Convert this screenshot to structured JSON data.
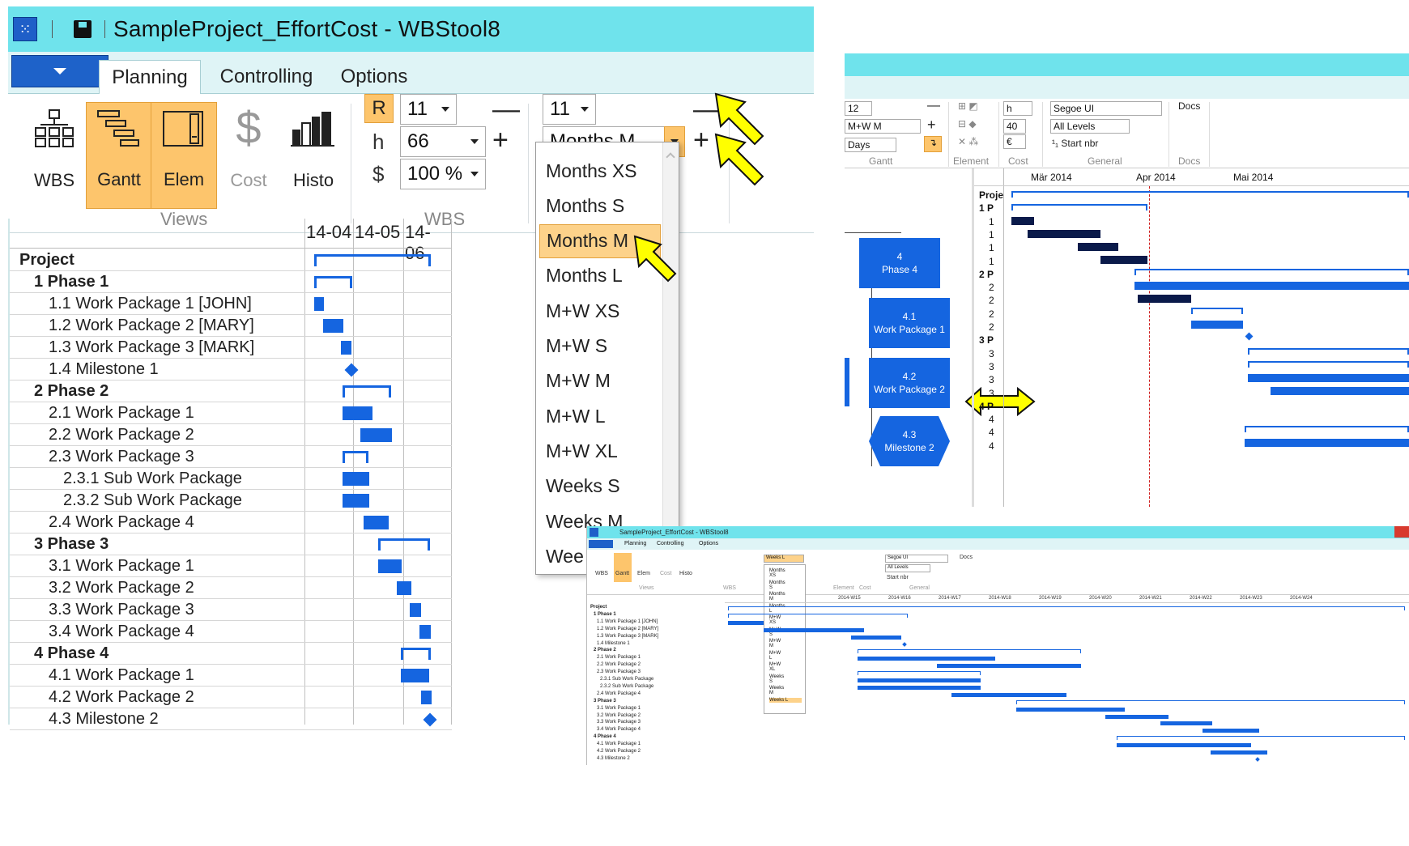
{
  "window": {
    "title": "SampleProject_EffortCost - WBStool8"
  },
  "tabs": [
    "Planning",
    "Controlling",
    "Options"
  ],
  "ribbon": {
    "views": {
      "group_label": "Views",
      "buttons": [
        "WBS",
        "Gantt",
        "Elem",
        "Cost",
        "Histo"
      ]
    },
    "wbs": {
      "group_label": "WBS",
      "r_label": "R",
      "h_label": "h",
      "dollar_label": "$",
      "r_value": "11",
      "h_value": "66",
      "zoom_value": "100 %"
    },
    "gantt": {
      "level_value": "11",
      "timescale_value": "Months M",
      "minus": "—",
      "plus": "+"
    }
  },
  "dropdown": {
    "options": [
      "Months XS",
      "Months S",
      "Months M",
      "Months L",
      "M+W XS",
      "M+W S",
      "M+W M",
      "M+W L",
      "M+W XL",
      "Weeks S",
      "Weeks M",
      "Wee"
    ],
    "selected": "Months M"
  },
  "gantt": {
    "columns": [
      "14-04",
      "14-05",
      "14-06"
    ],
    "rows": [
      {
        "label": "Project",
        "bold": true
      },
      {
        "label": "1 Phase 1",
        "bold": true
      },
      {
        "label": "1.1 Work Package 1 [JOHN]"
      },
      {
        "label": "1.2 Work Package 2 [MARY]"
      },
      {
        "label": "1.3 Work Package 3 [MARK]"
      },
      {
        "label": "1.4 Milestone 1"
      },
      {
        "label": "2 Phase 2",
        "bold": true
      },
      {
        "label": "2.1 Work Package 1"
      },
      {
        "label": "2.2 Work Package 2"
      },
      {
        "label": "2.3 Work Package 3"
      },
      {
        "label": "2.3.1 Sub Work Package"
      },
      {
        "label": "2.3.2 Sub Work Package"
      },
      {
        "label": "2.4 Work Package 4"
      },
      {
        "label": "3 Phase 3",
        "bold": true
      },
      {
        "label": "3.1 Work Package 1"
      },
      {
        "label": "3.2 Work Package 2"
      },
      {
        "label": "3.3 Work Package 3"
      },
      {
        "label": "3.4 Work Package 4"
      },
      {
        "label": "4 Phase 4",
        "bold": true
      },
      {
        "label": "4.1 Work Package 1"
      },
      {
        "label": "4.2 Work Package 2"
      },
      {
        "label": "4.3 Milestone 2"
      }
    ]
  },
  "top_right": {
    "level_value": "12",
    "timescale_value": "M+W M",
    "unit_value": "Days",
    "hours_value": "h",
    "num_value": "40",
    "currency_value": "€",
    "font_value": "Segoe UI",
    "levels_value": "All Levels",
    "start_nbr": "Start nbr",
    "docs": "Docs",
    "groups": [
      "Gantt",
      "Element",
      "Cost",
      "General",
      "Docs"
    ],
    "months": [
      "Mär 2014",
      "Apr 2014",
      "Mai 2014"
    ],
    "row_labels": [
      "Proje",
      "1 P",
      "1",
      "1",
      "1",
      "1",
      "2 P",
      "2",
      "2",
      "2",
      "2",
      "3 P",
      "3",
      "3",
      "3",
      "3",
      "4 P",
      "4",
      "4",
      "4"
    ],
    "wbs_boxes": [
      {
        "num": "4",
        "name": "Phase 4"
      },
      {
        "num": "4.1",
        "name": "Work Package 1"
      },
      {
        "num": "4.2",
        "name": "Work Package 2"
      },
      {
        "num": "4.3",
        "name": "Milestone 2"
      }
    ]
  },
  "bottom_right": {
    "title": "SampleProject_EffortCost - WBStool8",
    "tabs": [
      "Planning",
      "Controlling",
      "Options"
    ],
    "timescale_value": "Weeks L",
    "font_value": "Segoe UI",
    "levels_value": "All Levels",
    "start_nbr": "Start nbr",
    "docs": "Docs",
    "views_label": "Views",
    "wbs_label": "WBS",
    "gantt_label": "Gantt",
    "element_label": "Element",
    "cost_label": "Cost",
    "general_label": "General",
    "buttons": [
      "WBS",
      "Gantt",
      "Elem",
      "Cost",
      "Histo"
    ],
    "dd_options": [
      "Months XS",
      "Months S",
      "Months M",
      "Months L",
      "M+W XS",
      "M+W S",
      "M+W M",
      "M+W L",
      "M+W XL",
      "Weeks S",
      "Weeks M",
      "Weeks L"
    ],
    "weeks": [
      "2014-W15",
      "2014-W16",
      "2014-W17",
      "2014-W18",
      "2014-W19",
      "2014-W20",
      "2014-W21",
      "2014-W22",
      "2014-W23",
      "2014-W24"
    ],
    "rows": [
      "Project",
      "1 Phase 1",
      "1.1 Work Package 1 [JOHN]",
      "1.2 Work Package 2 [MARY]",
      "1.3 Work Package 3 [MARK]",
      "1.4 Milestone 1",
      "2 Phase 2",
      "2.1 Work Package 1",
      "2.2 Work Package 2",
      "2.3 Work Package 3",
      "2.3.1 Sub Work Package",
      "2.3.2 Sub Work Package",
      "2.4 Work Package 4",
      "3 Phase 3",
      "3.1 Work Package 1",
      "3.2 Work Package 2",
      "3.3 Work Package 3",
      "3.4 Work Package 4",
      "4 Phase 4",
      "4.1 Work Package 1",
      "4.2 Work Package 2",
      "4.3 Milestone 2"
    ]
  },
  "colors": {
    "titlebar": "#6fe3ec",
    "accent": "#fdc56c",
    "bar": "#1565e0",
    "arrow": "#ffff00"
  }
}
